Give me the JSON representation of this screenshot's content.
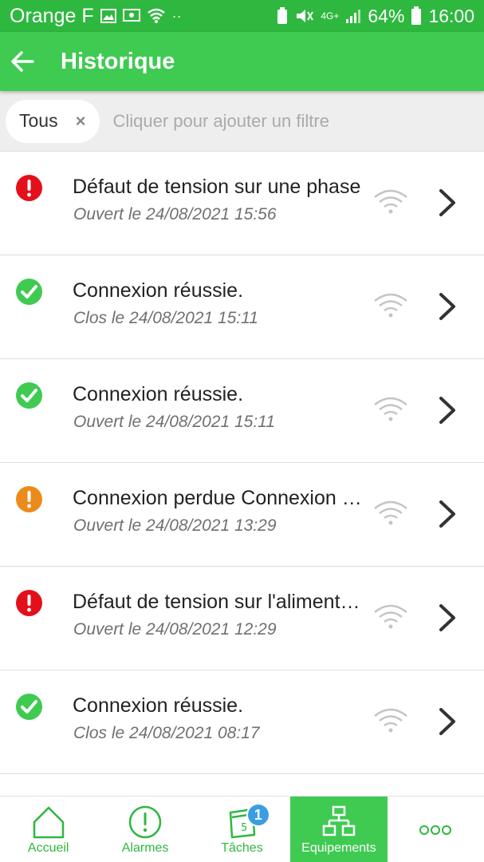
{
  "status_bar": {
    "carrier": "Orange F",
    "network": "4G+",
    "battery": "64%",
    "time": "16:00"
  },
  "header": {
    "title": "Historique",
    "back_icon": "arrow-left-icon"
  },
  "filter": {
    "chip_label": "Tous",
    "chip_close": "×",
    "placeholder": "Cliquer pour ajouter un filtre"
  },
  "events": [
    {
      "title": "Défaut de tension sur une phase",
      "subtitle": "Ouvert le 24/08/2021 15:56",
      "status": "error"
    },
    {
      "title": "Connexion réussie.",
      "subtitle": "Clos le 24/08/2021 15:11",
      "status": "ok"
    },
    {
      "title": "Connexion réussie.",
      "subtitle": "Ouvert le 24/08/2021 15:11",
      "status": "ok"
    },
    {
      "title": "Connexion perdue Connexion perdue",
      "subtitle": "Ouvert le 24/08/2021 13:29",
      "status": "warning"
    },
    {
      "title": "Défaut de tension sur l'alimentation",
      "subtitle": "Ouvert le 24/08/2021 12:29",
      "status": "error"
    },
    {
      "title": "Connexion réussie.",
      "subtitle": "Clos le 24/08/2021 08:17",
      "status": "ok"
    }
  ],
  "bottom_nav": {
    "items": [
      {
        "label": "Accueil",
        "icon": "home-icon"
      },
      {
        "label": "Alarmes",
        "icon": "alert-icon"
      },
      {
        "label": "Tâches",
        "icon": "calendar-icon",
        "badge": "1"
      },
      {
        "label": "Equipements",
        "icon": "network-icon",
        "active": true
      },
      {
        "label": "",
        "icon": "more-icon"
      }
    ]
  },
  "colors": {
    "primary": "#3fca52",
    "status_bar": "#2eb83f",
    "error": "#e3101b",
    "ok": "#3fca52",
    "warning": "#ec8a1c",
    "badge": "#3a9ee4"
  }
}
